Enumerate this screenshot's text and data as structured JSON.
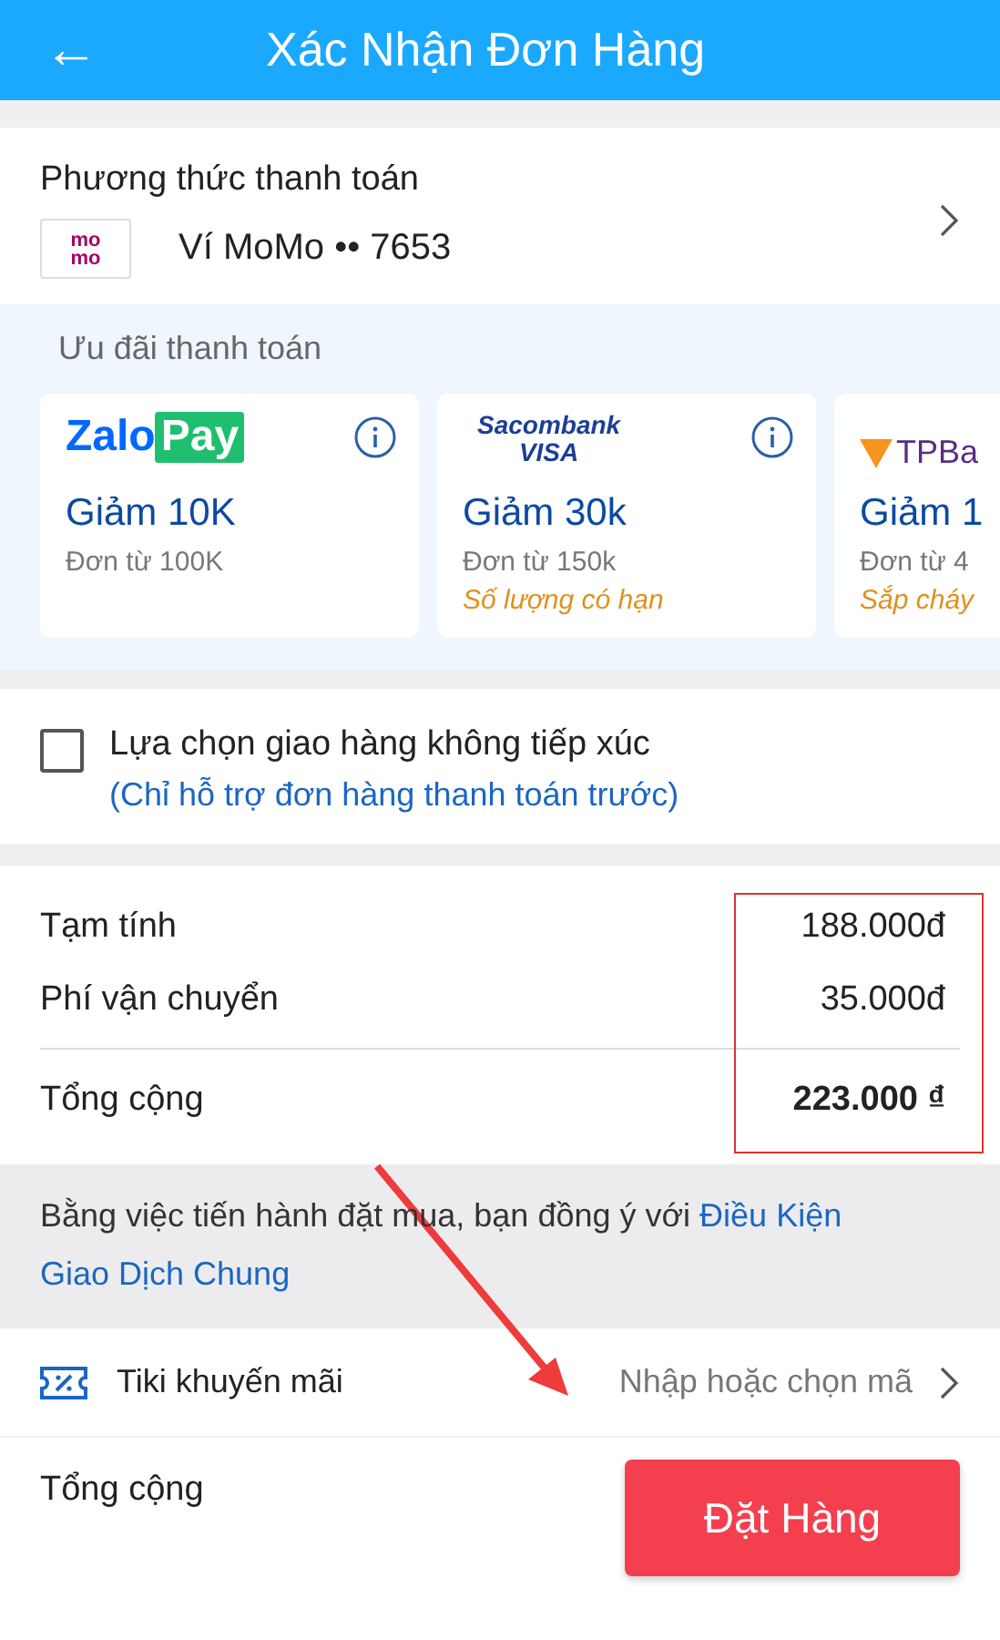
{
  "header": {
    "back_icon": "←",
    "title": "Xác Nhận Đơn Hàng"
  },
  "payment_method": {
    "title": "Phương thức thanh toán",
    "logo_text": "mo mo",
    "method": "Ví MoMo •• 7653"
  },
  "payment_offers": {
    "title": "Ưu đãi thanh toán",
    "cards": [
      {
        "kind": "zalopay",
        "logo": [
          "Zalo",
          "Pay"
        ],
        "discount": "Giảm 10K",
        "condition": "Đơn từ 100K",
        "info": true
      },
      {
        "kind": "sacombank",
        "logo": [
          "Sacombank",
          "VISA"
        ],
        "discount": "Giảm 30k",
        "condition": "Đơn từ 150k",
        "note": "Số lượng có hạn",
        "info": true
      },
      {
        "kind": "tpbank",
        "logo": [
          "TPBa"
        ],
        "discount": "Giảm 1",
        "condition": "Đơn từ 4",
        "note": "Sắp cháy",
        "info": false
      }
    ]
  },
  "contactless": {
    "label": "Lựa chọn giao hàng không tiếp xúc",
    "hint": "(Chỉ hỗ trợ đơn hàng thanh toán trước)",
    "checked": false
  },
  "totals": {
    "rows": [
      {
        "kind": "line",
        "label": "Tạm tính",
        "value": "188.000đ"
      },
      {
        "kind": "line",
        "label": "Phí vận chuyển",
        "value": "35.000đ"
      },
      {
        "kind": "total",
        "label": "Tổng cộng",
        "value": "223.000 ₫"
      }
    ],
    "highlighted": true
  },
  "terms": {
    "text": "Bằng việc tiến hành đặt mua, bạn đồng ý với ",
    "link_lines": [
      "Điều Kiện",
      "Giao Dịch Chung"
    ]
  },
  "promo": {
    "label": "Tiki khuyến mãi",
    "placeholder": "Nhập hoặc chọn mã"
  },
  "footer": {
    "label": "Tổng cộng",
    "button": "Đặt Hàng"
  },
  "annotation": {
    "arrow": true
  }
}
